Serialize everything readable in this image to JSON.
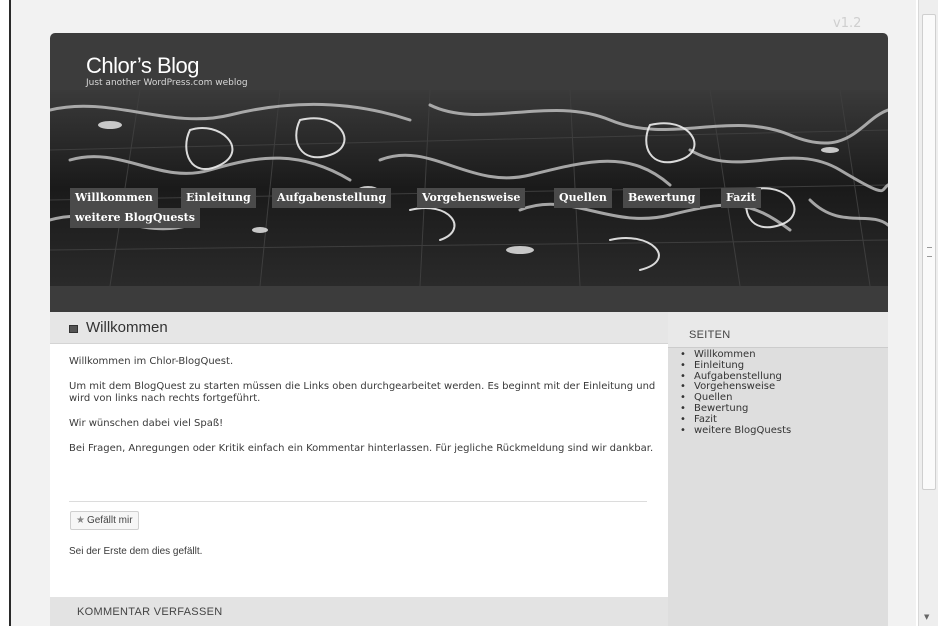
{
  "version_label": "v1.2",
  "blog": {
    "title": "Chlor’s Blog",
    "tagline": "Just another WordPress.com weblog"
  },
  "nav": {
    "items": [
      "Willkommen",
      "Einleitung",
      "Aufgabenstellung",
      "Vorgehensweise",
      "Quellen",
      "Bewertung",
      "Fazit",
      "weitere BlogQuests"
    ]
  },
  "post": {
    "title": "Willkommen",
    "paragraphs": [
      "Willkommen im Chlor-BlogQuest.",
      "Um mit dem BlogQuest zu starten müssen die Links oben durchgearbeitet werden. Es beginnt mit der Einleitung und wird von links nach rechts fortgeführt.",
      "Wir wünschen dabei viel Spaß!",
      "Bei Fragen, Anregungen oder Kritik einfach ein Kommentar hinterlassen. Für jegliche Rückmeldung sind wir dankbar."
    ],
    "like_label": "Gefällt mir",
    "like_icon": "star-icon",
    "like_note": "Sei der Erste dem dies gefällt.",
    "comment_label": "KOMMENTAR VERFASSEN"
  },
  "sidebar": {
    "title": "SEITEN",
    "items": [
      "Willkommen",
      "Einleitung",
      "Aufgabenstellung",
      "Vorgehensweise",
      "Quellen",
      "Bewertung",
      "Fazit",
      "weitere BlogQuests"
    ]
  }
}
